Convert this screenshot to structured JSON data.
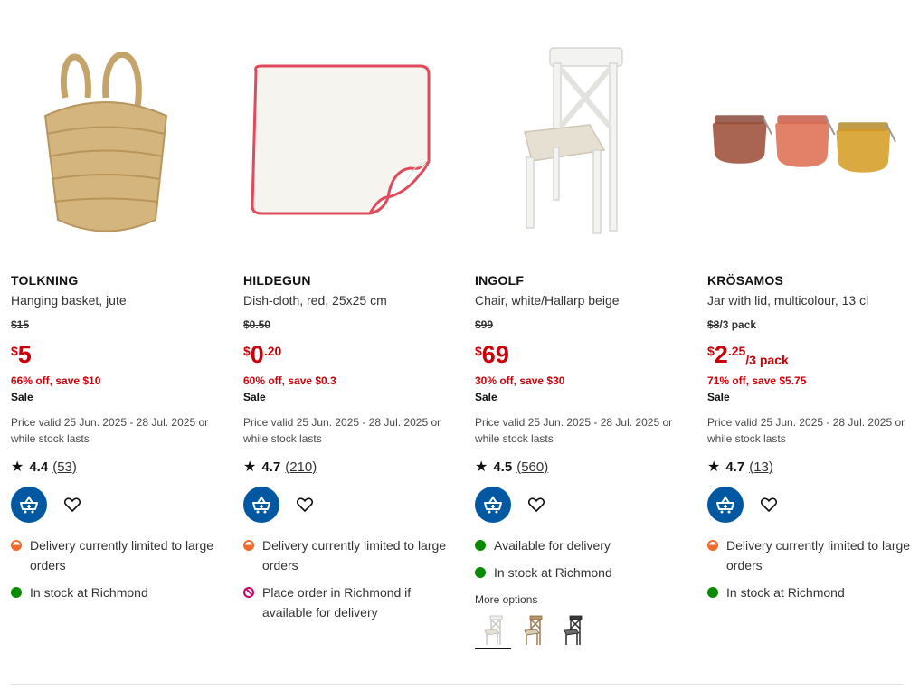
{
  "products": [
    {
      "name": "TOLKNING",
      "description": "Hanging basket, jute",
      "was_price": "$15",
      "was_suffix": "",
      "price_currency": "$",
      "price_int": "5",
      "price_dec": "",
      "price_unit": "",
      "savings": "66% off, save $10",
      "sale_label": "Sale",
      "validity": "Price valid 25 Jun. 2025 - 28 Jul. 2025 or while stock lasts",
      "rating": "4.4",
      "review_count": "(53)",
      "availability": [
        {
          "status": "limited",
          "text": "Delivery currently limited to large orders"
        },
        {
          "status": "in-stock",
          "text": "In stock at Richmond"
        }
      ]
    },
    {
      "name": "HILDEGUN",
      "description": "Dish-cloth, red, 25x25 cm",
      "was_price": "$0.50",
      "was_suffix": "",
      "price_currency": "$",
      "price_int": "0",
      "price_dec": ".20",
      "price_unit": "",
      "savings": "60% off, save $0.3",
      "sale_label": "Sale",
      "validity": "Price valid 25 Jun. 2025 - 28 Jul. 2025 or while stock lasts",
      "rating": "4.7",
      "review_count": "(210)",
      "availability": [
        {
          "status": "limited",
          "text": "Delivery currently limited to large orders"
        },
        {
          "status": "no-order",
          "text": "Place order in Richmond if available for delivery"
        }
      ]
    },
    {
      "name": "INGOLF",
      "description": "Chair, white/Hallarp beige",
      "was_price": "$99",
      "was_suffix": "",
      "price_currency": "$",
      "price_int": "69",
      "price_dec": "",
      "price_unit": "",
      "savings": "30% off, save $30",
      "sale_label": "Sale",
      "validity": "Price valid 25 Jun. 2025 - 28 Jul. 2025 or while stock lasts",
      "rating": "4.5",
      "review_count": "(560)",
      "availability": [
        {
          "status": "in-stock",
          "text": "Available for delivery"
        },
        {
          "status": "in-stock",
          "text": "In stock at Richmond"
        }
      ],
      "more_options_label": "More options"
    },
    {
      "name": "KRÖSAMOS",
      "description": "Jar with lid, multicolour, 13 cl",
      "was_price": "$8",
      "was_suffix": "/3 pack",
      "price_currency": "$",
      "price_int": "2",
      "price_dec": ".25",
      "price_unit": "/3 pack",
      "savings": "71% off, save $5.75",
      "sale_label": "Sale",
      "validity": "Price valid 25 Jun. 2025 - 28 Jul. 2025 or while stock lasts",
      "rating": "4.7",
      "review_count": "(13)",
      "availability": [
        {
          "status": "limited",
          "text": "Delivery currently limited to large orders"
        },
        {
          "status": "in-stock",
          "text": "In stock at Richmond"
        }
      ]
    }
  ],
  "icons": {
    "star": "star-icon",
    "cart": "add-to-cart-icon",
    "favourite": "heart-icon"
  },
  "colors": {
    "accent": "#0058a3",
    "sale": "#cc0008",
    "in_stock": "#0a8a00",
    "limited": "#f26a2e",
    "no_order": "#cc0061"
  }
}
